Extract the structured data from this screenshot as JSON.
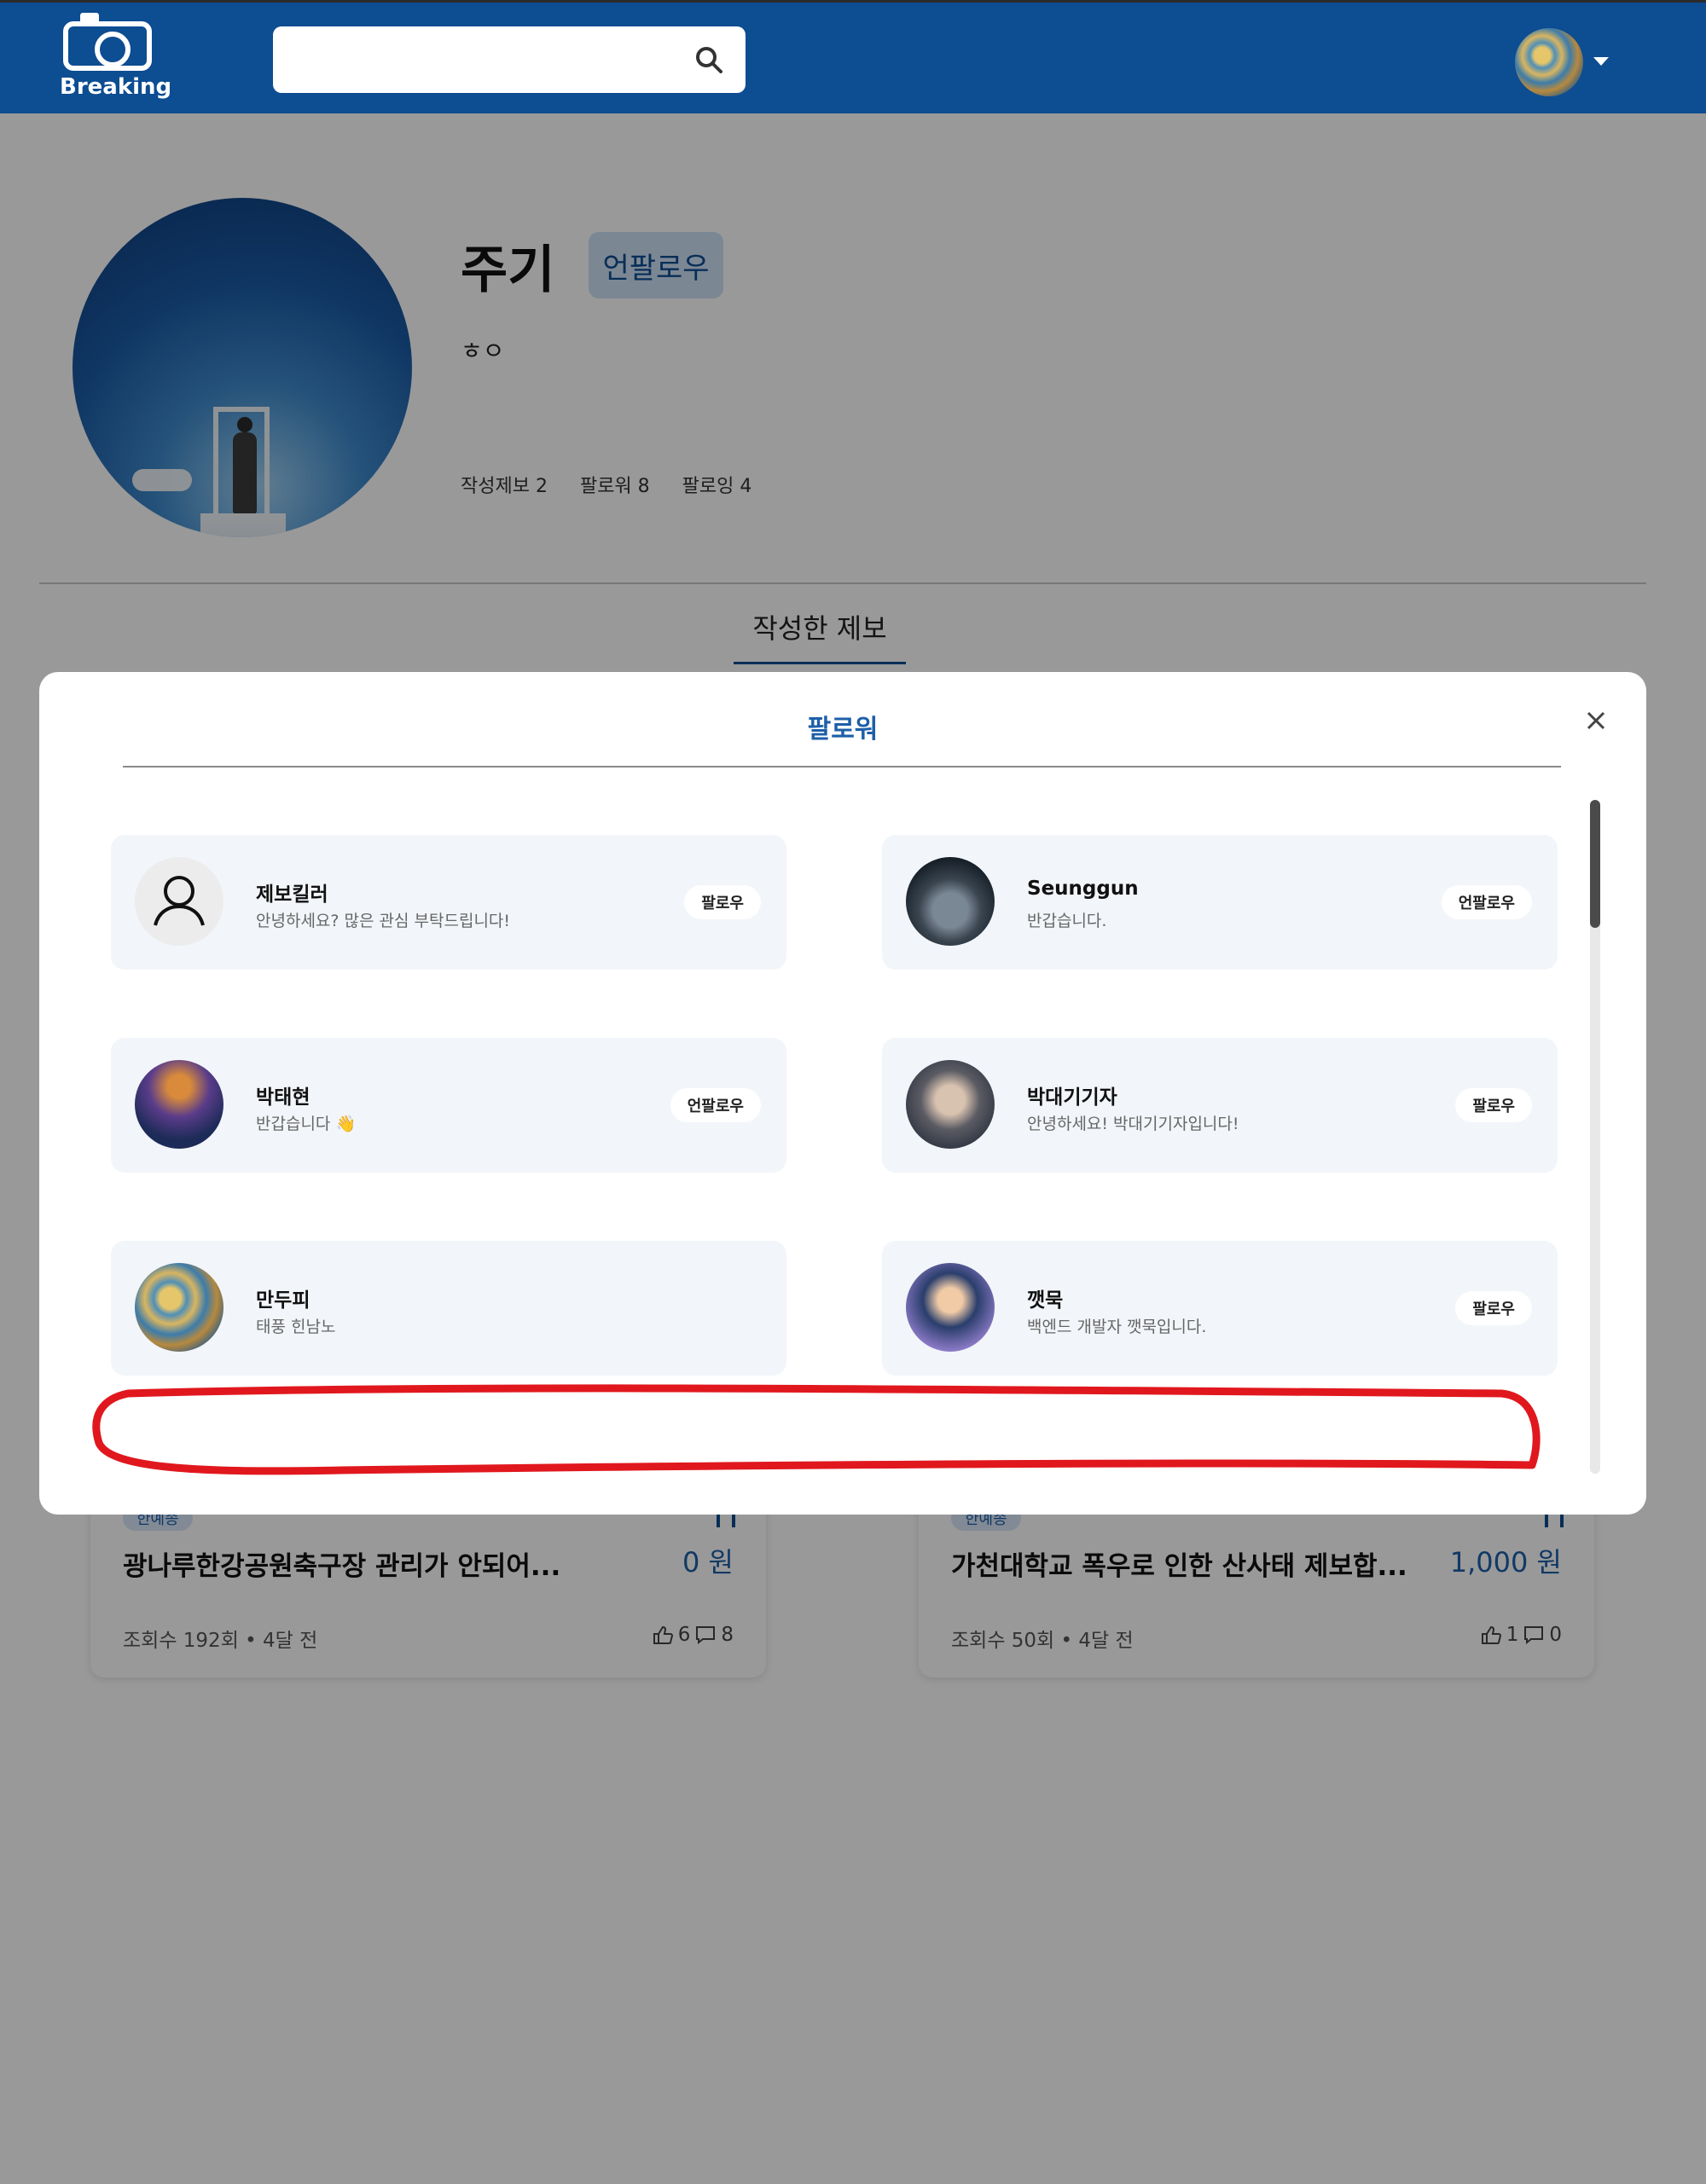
{
  "header": {
    "logo_text": "Breaking",
    "search_placeholder": ""
  },
  "profile": {
    "name": "주기",
    "follow_button": "언팔로우",
    "bio": "ㅎㅇ",
    "stats": {
      "reports": "작성제보 2",
      "followers": "팔로워 8",
      "following": "팔로잉 4"
    },
    "tab": "작성한 제보"
  },
  "cards": [
    {
      "tag": "한예종",
      "title": "광나루한강공원축구장 관리가 안되어...",
      "price": "0 원",
      "meta": "조회수 192회 • 4달 전",
      "likes": "6",
      "comments": "8"
    },
    {
      "tag": "한예종",
      "title": "가천대학교 폭우로 인한 산사태 제보합...",
      "price": "1,000 원",
      "meta": "조회수 50회 • 4달 전",
      "likes": "1",
      "comments": "0"
    }
  ],
  "modal": {
    "title": "팔로워",
    "followers": [
      {
        "name": "제보킬러",
        "bio": "안녕하세요? 많은 관심 부탁드립니다!",
        "button": "팔로우"
      },
      {
        "name": "Seunggun",
        "bio": "반갑습니다.",
        "button": "언팔로우"
      },
      {
        "name": "박태현",
        "bio": "반갑습니다 👋",
        "button": "언팔로우"
      },
      {
        "name": "박대기기자",
        "bio": "안녕하세요! 박대기기자입니다!",
        "button": "팔로우"
      },
      {
        "name": "만두피",
        "bio": "태풍 힌남노",
        "button": ""
      },
      {
        "name": "깻묵",
        "bio": "백엔드 개발자 깻묵입니다.",
        "button": "팔로우"
      }
    ]
  },
  "colors": {
    "header_bg": "#0d4d92",
    "accent": "#1d5fa8",
    "annotation": "#e0181e"
  }
}
